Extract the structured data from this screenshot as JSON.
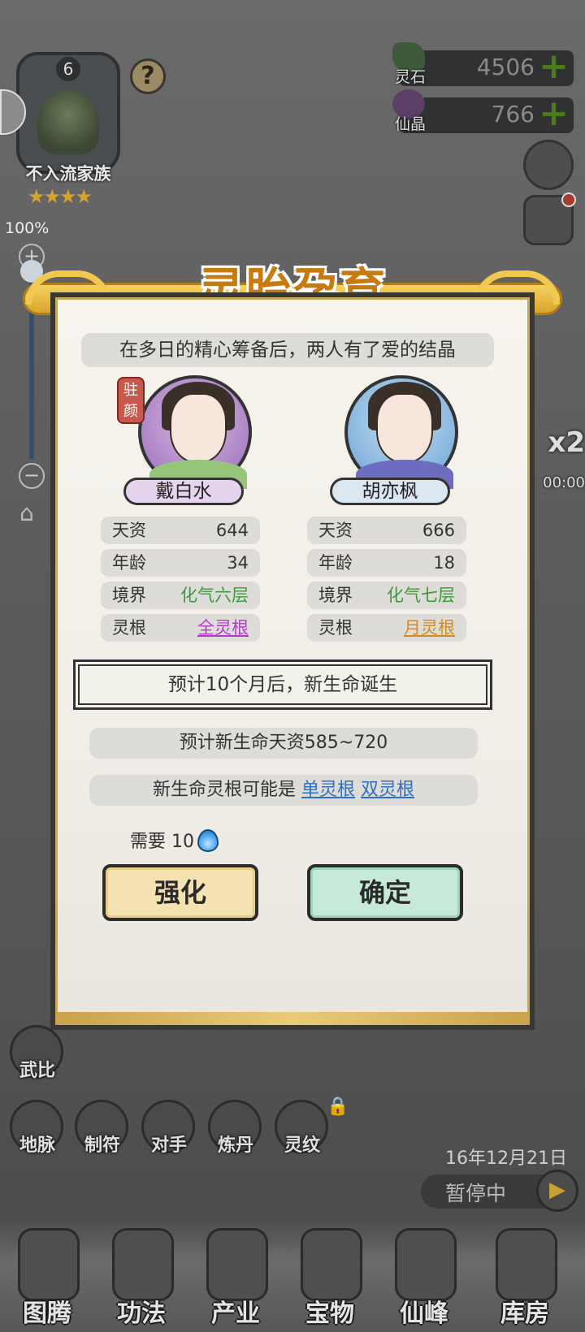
{
  "family": {
    "level": "6",
    "name": "不入流家族",
    "stars": "★★★★",
    "zoom_percent": "100%",
    "zoom_plus": "+",
    "zoom_minus": "−"
  },
  "help_icon": "?",
  "currencies": [
    {
      "label": "灵石",
      "value": "4506",
      "add": "+"
    },
    {
      "label": "仙晶",
      "value": "766",
      "add": "+"
    }
  ],
  "speed": {
    "multiplier": "x2",
    "time": "00:00"
  },
  "modal": {
    "title": "灵胎孕育",
    "subtitle": "在多日的精心筹备后，两人有了爱的结晶",
    "left": {
      "badge": "驻颜",
      "name": "戴白水",
      "stats": [
        {
          "k": "天资",
          "v": "644"
        },
        {
          "k": "年龄",
          "v": "34"
        },
        {
          "k": "境界",
          "v": "化气六层"
        },
        {
          "k": "灵根",
          "v": "全灵根"
        }
      ]
    },
    "right": {
      "name": "胡亦枫",
      "stats": [
        {
          "k": "天资",
          "v": "666"
        },
        {
          "k": "年龄",
          "v": "18"
        },
        {
          "k": "境界",
          "v": "化气七层"
        },
        {
          "k": "灵根",
          "v": "月灵根"
        }
      ]
    },
    "predict_birth": "预计10个月后，新生命诞生",
    "predict_talent": "预计新生命天资585~720",
    "root_prefix": "新生命灵根可能是",
    "root_options": [
      "单灵根",
      "双灵根"
    ],
    "cost_label": "需要",
    "cost_value": "10",
    "btn_strengthen": "强化",
    "btn_confirm": "确定"
  },
  "side_actions": [
    {
      "label": "武比"
    },
    {
      "label": "地脉"
    },
    {
      "label": "制符"
    },
    {
      "label": "对手"
    },
    {
      "label": "炼丹"
    },
    {
      "label": "灵纹"
    }
  ],
  "game_date": "16年12月21日",
  "pause_label": "暂停中",
  "bottom_nav": [
    "图腾",
    "功法",
    "产业",
    "宝物",
    "仙峰",
    "库房"
  ],
  "colors": {
    "realm_green": "#3b9a3b",
    "root_purple": "#b13bc6",
    "root_orange": "#d08c22",
    "link_blue": "#2d6fc0",
    "title_gold": "#c77a10"
  }
}
